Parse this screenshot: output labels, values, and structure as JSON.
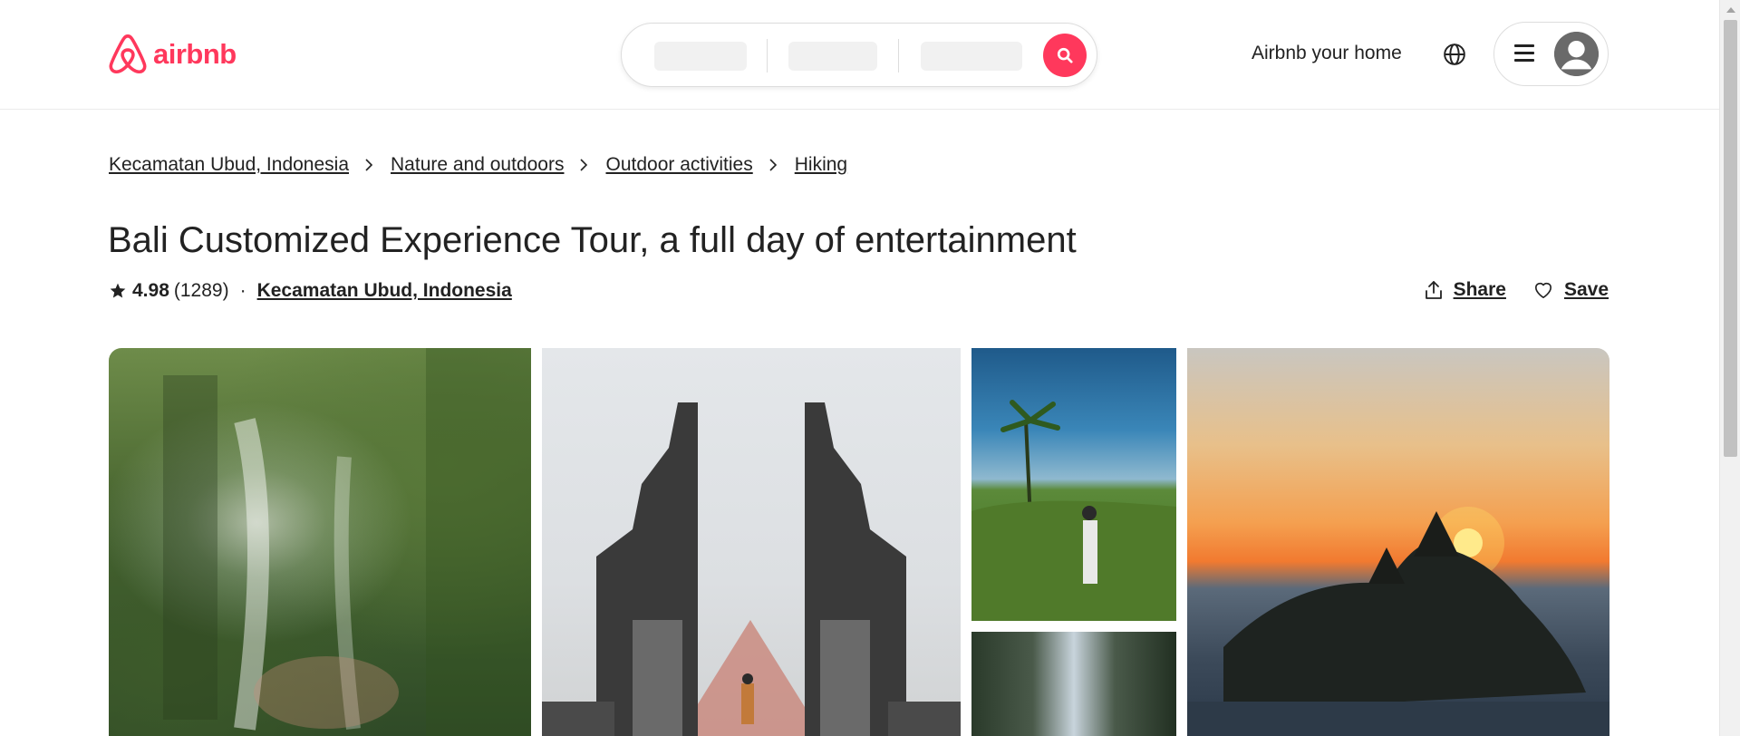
{
  "header": {
    "logo_text": "airbnb",
    "brand_color": "#ff385c",
    "host_link": "Airbnb your home",
    "icons": {
      "logo": "airbnb-logo-icon",
      "search": "search-icon",
      "globe": "globe-icon",
      "menu": "hamburger-menu-icon",
      "avatar": "user-avatar-icon"
    }
  },
  "breadcrumb": [
    "Kecamatan Ubud, Indonesia",
    "Nature and outdoors",
    "Outdoor activities",
    "Hiking"
  ],
  "listing": {
    "title": "Bali Customized Experience Tour, a full day of entertainment",
    "rating": "4.98",
    "review_count": "(1289)",
    "separator": "·",
    "location": "Kecamatan Ubud, Indonesia",
    "share_label": "Share",
    "save_label": "Save"
  },
  "gallery": {
    "photos": [
      "waterfall-forest-photo",
      "temple-gate-photo",
      "rice-terrace-photo",
      "waterfall-cave-photo",
      "sea-temple-sunset-photo"
    ]
  }
}
